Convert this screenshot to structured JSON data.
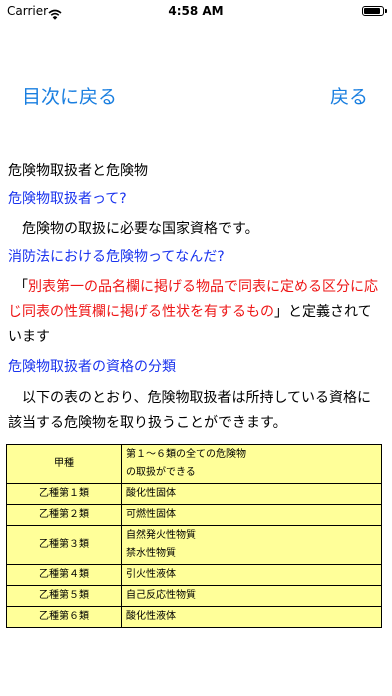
{
  "status": {
    "carrier": "Carrier",
    "time": "4:58 AM",
    "battery_level": 0.95
  },
  "nav": {
    "toc_label": "目次に戻る",
    "back_label": "戻る"
  },
  "content": {
    "title": "危険物取扱者と危険物",
    "q1": "危険物取扱者って?",
    "a1": "　危険物の取扱に必要な国家資格です。",
    "q2": "消防法における危険物ってなんだ?",
    "def_open": "「",
    "def_red": "別表第一の品名欄に掲げる物品で同表に定める区分に応じ同表の性質欄に掲げる性状を有するもの",
    "def_close": "」と定義されています",
    "q3": "危険物取扱者の資格の分類",
    "a3": "　以下の表のとおり、危険物取扱者は所持している資格に該当する危険物を取り扱うことができます。"
  },
  "table": {
    "rows": [
      {
        "kind": "甲種",
        "lines": [
          "第１～６類の全ての危険物",
          "の取扱ができる"
        ]
      },
      {
        "kind": "乙種第１類",
        "lines": [
          "酸化性固体"
        ]
      },
      {
        "kind": "乙種第２類",
        "lines": [
          "可燃性固体"
        ]
      },
      {
        "kind": "乙種第３類",
        "lines": [
          "自然発火性物質",
          "禁水性物質"
        ]
      },
      {
        "kind": "乙種第４類",
        "lines": [
          "引火性液体"
        ]
      },
      {
        "kind": "乙種第５類",
        "lines": [
          "自己反応性物質"
        ]
      },
      {
        "kind": "乙種第６類",
        "lines": [
          "酸化性液体"
        ]
      }
    ]
  }
}
